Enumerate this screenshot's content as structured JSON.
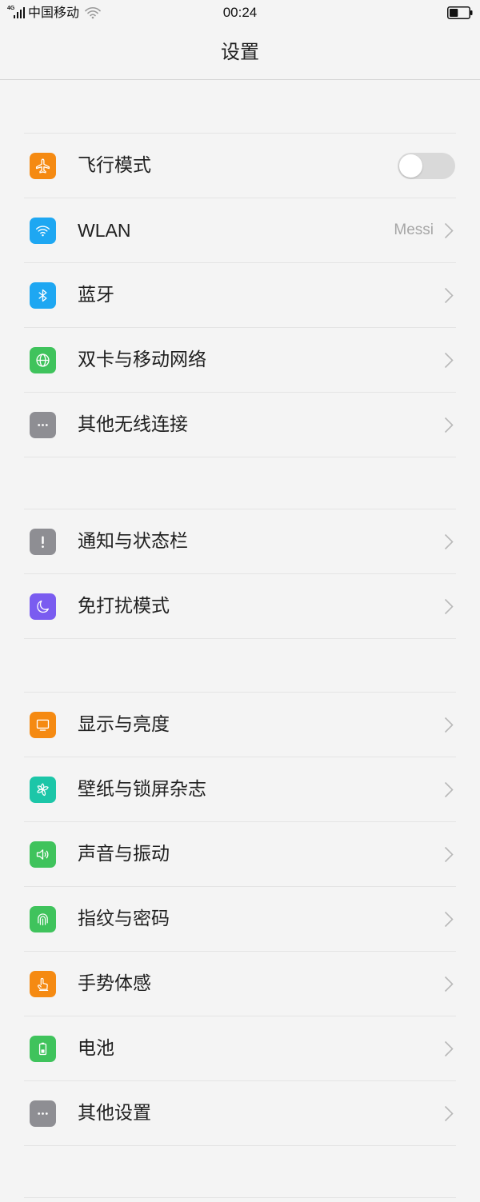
{
  "status_bar": {
    "network": "4G",
    "carrier": "中国移动",
    "time": "00:24",
    "battery_level": 0.45
  },
  "header": {
    "title": "设置"
  },
  "groups": [
    {
      "items": [
        {
          "label": "飞行模式",
          "icon": "airplane-icon",
          "color": "#f58a12",
          "control": "toggle",
          "toggle_on": false
        },
        {
          "label": "WLAN",
          "icon": "wifi-icon",
          "color": "#1ea7f2",
          "control": "chevron",
          "value": "Messi"
        },
        {
          "label": "蓝牙",
          "icon": "bluetooth-icon",
          "color": "#1ea7f2",
          "control": "chevron"
        },
        {
          "label": "双卡与移动网络",
          "icon": "globe-icon",
          "color": "#3fc35c",
          "control": "chevron"
        },
        {
          "label": "其他无线连接",
          "icon": "more-dots-icon",
          "color": "#8e8e93",
          "control": "chevron"
        }
      ]
    },
    {
      "items": [
        {
          "label": "通知与状态栏",
          "icon": "exclamation-icon",
          "color": "#8e8e93",
          "control": "chevron"
        },
        {
          "label": "免打扰模式",
          "icon": "moon-icon",
          "color": "#7a5cf0",
          "control": "chevron"
        }
      ]
    },
    {
      "items": [
        {
          "label": "显示与亮度",
          "icon": "display-icon",
          "color": "#f58a12",
          "control": "chevron"
        },
        {
          "label": "壁纸与锁屏杂志",
          "icon": "pinwheel-icon",
          "color": "#1cc6a8",
          "control": "chevron"
        },
        {
          "label": "声音与振动",
          "icon": "speaker-icon",
          "color": "#3fc35c",
          "control": "chevron"
        },
        {
          "label": "指纹与密码",
          "icon": "fingerprint-icon",
          "color": "#3fc35c",
          "control": "chevron"
        },
        {
          "label": "手势体感",
          "icon": "gesture-hand-icon",
          "color": "#f58a12",
          "control": "chevron"
        },
        {
          "label": "电池",
          "icon": "battery-icon",
          "color": "#3fc35c",
          "control": "chevron"
        },
        {
          "label": "其他设置",
          "icon": "more-dots-icon",
          "color": "#8e8e93",
          "control": "chevron"
        }
      ]
    }
  ]
}
